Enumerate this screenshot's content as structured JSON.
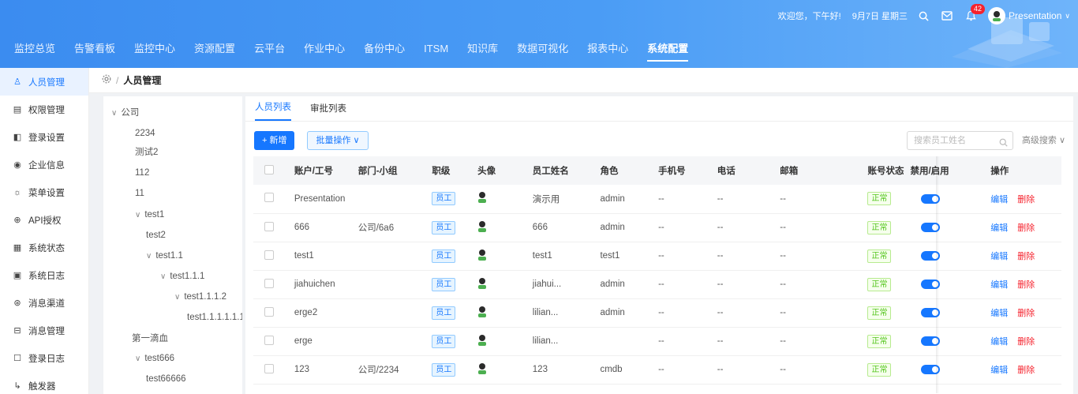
{
  "header": {
    "greeting": "欢迎您，下午好!",
    "date": "9月7日 星期三",
    "notification_count": "42",
    "username": "Presentation",
    "nav": [
      "监控总览",
      "告警看板",
      "监控中心",
      "资源配置",
      "云平台",
      "作业中心",
      "备份中心",
      "ITSM",
      "知识库",
      "数据可视化",
      "报表中心",
      "系统配置"
    ]
  },
  "sidebar": {
    "items": [
      {
        "label": "人员管理",
        "icon": "user-icon"
      },
      {
        "label": "权限管理",
        "icon": "permission-icon"
      },
      {
        "label": "登录设置",
        "icon": "login-settings-icon"
      },
      {
        "label": "企业信息",
        "icon": "enterprise-icon"
      },
      {
        "label": "菜单设置",
        "icon": "menu-settings-icon"
      },
      {
        "label": "API授权",
        "icon": "api-icon"
      },
      {
        "label": "系统状态",
        "icon": "grid-icon"
      },
      {
        "label": "系统日志",
        "icon": "log-icon"
      },
      {
        "label": "消息渠道",
        "icon": "channel-icon"
      },
      {
        "label": "消息管理",
        "icon": "message-icon"
      },
      {
        "label": "登录日志",
        "icon": "login-log-icon"
      },
      {
        "label": "触发器",
        "icon": "trigger-icon"
      }
    ]
  },
  "breadcrumb": {
    "current": "人员管理"
  },
  "tree": {
    "nodes": [
      {
        "label": "公司",
        "caret": "∨"
      },
      {
        "label": "2234",
        "caret": ""
      },
      {
        "label": "测试2",
        "caret": ""
      },
      {
        "label": "112",
        "caret": ""
      },
      {
        "label": "11",
        "caret": ""
      },
      {
        "label": "test1",
        "caret": "∨"
      },
      {
        "label": "test2",
        "caret": ""
      },
      {
        "label": "test1.1",
        "caret": "∨"
      },
      {
        "label": "test1.1.1",
        "caret": "∨"
      },
      {
        "label": "test1.1.1.2",
        "caret": "∨"
      },
      {
        "label": "test1.1.1.1.1.1.1",
        "caret": ""
      },
      {
        "label": "第一滴血",
        "caret": ""
      },
      {
        "label": "test666",
        "caret": "∨"
      },
      {
        "label": "test66666",
        "caret": ""
      }
    ]
  },
  "main": {
    "tabs": [
      "人员列表",
      "审批列表"
    ],
    "add_label": "+ 新增",
    "batch_label": "批量操作 ∨",
    "search_placeholder": "搜索员工姓名",
    "advanced_search": "高级搜索 ∨",
    "columns": [
      "账户/工号",
      "部门-小组",
      "职级",
      "头像",
      "员工姓名",
      "角色",
      "手机号",
      "电话",
      "邮箱",
      "账号状态",
      "禁用/启用",
      "操作"
    ],
    "rows": [
      {
        "account": "Presentation",
        "dept": "",
        "level": "员工",
        "name": "演示用",
        "role": "admin",
        "mobile": "--",
        "phone": "--",
        "email": "--",
        "status": "正常",
        "edit": "编辑",
        "delete": "删除"
      },
      {
        "account": "666",
        "dept": "公司/6a6",
        "level": "员工",
        "name": "666",
        "role": "admin",
        "mobile": "--",
        "phone": "--",
        "email": "--",
        "status": "正常",
        "edit": "编辑",
        "delete": "删除"
      },
      {
        "account": "test1",
        "dept": "",
        "level": "员工",
        "name": "test1",
        "role": "test1",
        "mobile": "--",
        "phone": "--",
        "email": "--",
        "status": "正常",
        "edit": "编辑",
        "delete": "删除"
      },
      {
        "account": "jiahuichen",
        "dept": "",
        "level": "员工",
        "name": "jiahui...",
        "role": "admin",
        "mobile": "--",
        "phone": "--",
        "email": "--",
        "status": "正常",
        "edit": "编辑",
        "delete": "删除"
      },
      {
        "account": "erge2",
        "dept": "",
        "level": "员工",
        "name": "lilian...",
        "role": "admin",
        "mobile": "--",
        "phone": "--",
        "email": "--",
        "status": "正常",
        "edit": "编辑",
        "delete": "删除"
      },
      {
        "account": "erge",
        "dept": "",
        "level": "员工",
        "name": "lilian...",
        "role": "",
        "mobile": "--",
        "phone": "--",
        "email": "--",
        "status": "正常",
        "edit": "编辑",
        "delete": "删除"
      },
      {
        "account": "123",
        "dept": "公司/2234",
        "level": "员工",
        "name": "123",
        "role": "cmdb",
        "mobile": "--",
        "phone": "--",
        "email": "--",
        "status": "正常",
        "edit": "编辑",
        "delete": "删除"
      }
    ]
  }
}
